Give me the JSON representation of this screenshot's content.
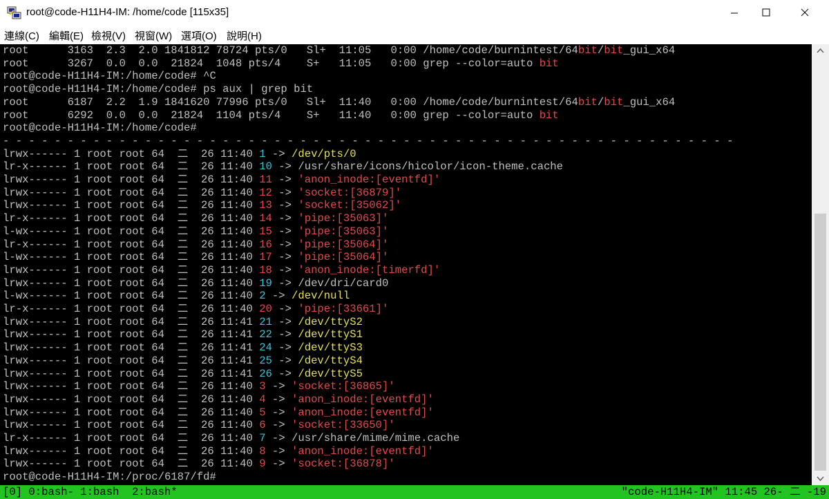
{
  "window": {
    "title": "root@code-H11H4-IM: /home/code [115x35]",
    "icons": [
      "putty-app-icon",
      "minimize-icon",
      "maximize-icon",
      "close-icon"
    ]
  },
  "menu": [
    "連線(C)",
    "編輯(E)",
    "檢視(V)",
    "視窗(W)",
    "選項(O)",
    "說明(H)"
  ],
  "colors": {
    "terminal_bg": "#000000",
    "default_text": "#c0c0c0",
    "red": "#e24a4a",
    "cyan": "#3ec1d6",
    "yellow": "#e6e05a",
    "status_bg": "#22c422"
  },
  "terminal": {
    "lines": [
      [
        {
          "t": "root      3163  2.3  2.0 1841812 78724 pts/0   Sl+  11:05   0:00 /home/code/burnintest/64"
        },
        {
          "t": "bit",
          "c": "red"
        },
        {
          "t": "/"
        },
        {
          "t": "bit",
          "c": "red"
        },
        {
          "t": "_gui_x64"
        }
      ],
      [
        {
          "t": "root      3267  0.0  0.0  21824  1048 pts/4    S+   11:05   0:00 grep --color=auto "
        },
        {
          "t": "bit",
          "c": "red"
        }
      ],
      [
        {
          "t": "root@code-H11H4-IM:/home/code# ^C"
        }
      ],
      [
        {
          "t": "root@code-H11H4-IM:/home/code# ps aux | grep bit"
        }
      ],
      [
        {
          "t": "root      6187  2.2  1.9 1841620 77996 pts/0   Sl+  11:40   0:00 /home/code/burnintest/64"
        },
        {
          "t": "bit",
          "c": "red"
        },
        {
          "t": "/"
        },
        {
          "t": "bit",
          "c": "red"
        },
        {
          "t": "_gui_x64"
        }
      ],
      [
        {
          "t": "root      6292  0.0  0.0  21824  1104 pts/4    S+   11:40   0:00 grep --color=auto "
        },
        {
          "t": "bit",
          "c": "red"
        }
      ],
      [
        {
          "t": "root@code-H11H4-IM:/home/code#"
        }
      ],
      [
        {
          "t": "- - - - - - - - - - - - - - - - - - - - - - - - - - - - - - - - - - - - - - - - - - - - - - - - - - - - - - - - -"
        }
      ],
      [
        {
          "t": "lrwx------ 1 root root 64  二  26 11:40 "
        },
        {
          "t": "1",
          "c": "cyan"
        },
        {
          "t": " -> "
        },
        {
          "t": "/dev/pts/0",
          "c": "yellow"
        }
      ],
      [
        {
          "t": "lr-x------ 1 root root 64  二  26 11:40 "
        },
        {
          "t": "10",
          "c": "cyan"
        },
        {
          "t": " -> /usr/share/icons/hicolor/icon-theme.cache"
        }
      ],
      [
        {
          "t": "lrwx------ 1 root root 64  二  26 11:40 "
        },
        {
          "t": "11",
          "c": "red"
        },
        {
          "t": " -> "
        },
        {
          "t": "'anon_inode:[eventfd]'",
          "c": "red"
        }
      ],
      [
        {
          "t": "lrwx------ 1 root root 64  二  26 11:40 "
        },
        {
          "t": "12",
          "c": "red"
        },
        {
          "t": " -> "
        },
        {
          "t": "'socket:[36879]'",
          "c": "red"
        }
      ],
      [
        {
          "t": "lrwx------ 1 root root 64  二  26 11:40 "
        },
        {
          "t": "13",
          "c": "red"
        },
        {
          "t": " -> "
        },
        {
          "t": "'socket:[35062]'",
          "c": "red"
        }
      ],
      [
        {
          "t": "lr-x------ 1 root root 64  二  26 11:40 "
        },
        {
          "t": "14",
          "c": "red"
        },
        {
          "t": " -> "
        },
        {
          "t": "'pipe:[35063]'",
          "c": "red"
        }
      ],
      [
        {
          "t": "l-wx------ 1 root root 64  二  26 11:40 "
        },
        {
          "t": "15",
          "c": "red"
        },
        {
          "t": " -> "
        },
        {
          "t": "'pipe:[35063]'",
          "c": "red"
        }
      ],
      [
        {
          "t": "lr-x------ 1 root root 64  二  26 11:40 "
        },
        {
          "t": "16",
          "c": "red"
        },
        {
          "t": " -> "
        },
        {
          "t": "'pipe:[35064]'",
          "c": "red"
        }
      ],
      [
        {
          "t": "l-wx------ 1 root root 64  二  26 11:40 "
        },
        {
          "t": "17",
          "c": "red"
        },
        {
          "t": " -> "
        },
        {
          "t": "'pipe:[35064]'",
          "c": "red"
        }
      ],
      [
        {
          "t": "lrwx------ 1 root root 64  二  26 11:40 "
        },
        {
          "t": "18",
          "c": "red"
        },
        {
          "t": " -> "
        },
        {
          "t": "'anon_inode:[timerfd]'",
          "c": "red"
        }
      ],
      [
        {
          "t": "lrwx------ 1 root root 64  二  26 11:40 "
        },
        {
          "t": "19",
          "c": "cyan"
        },
        {
          "t": " -> /dev/dri/card0"
        }
      ],
      [
        {
          "t": "l-wx------ 1 root root 64  二  26 11:40 "
        },
        {
          "t": "2",
          "c": "cyan"
        },
        {
          "t": " -> "
        },
        {
          "t": "/dev/null",
          "c": "yellow"
        }
      ],
      [
        {
          "t": "lr-x------ 1 root root 64  二  26 11:40 "
        },
        {
          "t": "20",
          "c": "red"
        },
        {
          "t": " -> "
        },
        {
          "t": "'pipe:[33661]'",
          "c": "red"
        }
      ],
      [
        {
          "t": "lrwx------ 1 root root 64  二  26 11:41 "
        },
        {
          "t": "21",
          "c": "cyan"
        },
        {
          "t": " -> "
        },
        {
          "t": "/dev/ttyS2",
          "c": "yellow"
        }
      ],
      [
        {
          "t": "lrwx------ 1 root root 64  二  26 11:41 "
        },
        {
          "t": "22",
          "c": "cyan"
        },
        {
          "t": " -> "
        },
        {
          "t": "/dev/ttyS1",
          "c": "yellow"
        }
      ],
      [
        {
          "t": "lrwx------ 1 root root 64  二  26 11:41 "
        },
        {
          "t": "24",
          "c": "cyan"
        },
        {
          "t": " -> "
        },
        {
          "t": "/dev/ttyS3",
          "c": "yellow"
        }
      ],
      [
        {
          "t": "lrwx------ 1 root root 64  二  26 11:41 "
        },
        {
          "t": "25",
          "c": "cyan"
        },
        {
          "t": " -> "
        },
        {
          "t": "/dev/ttyS4",
          "c": "yellow"
        }
      ],
      [
        {
          "t": "lrwx------ 1 root root 64  二  26 11:41 "
        },
        {
          "t": "26",
          "c": "cyan"
        },
        {
          "t": " -> "
        },
        {
          "t": "/dev/ttyS5",
          "c": "yellow"
        }
      ],
      [
        {
          "t": "lrwx------ 1 root root 64  二  26 11:40 "
        },
        {
          "t": "3",
          "c": "red"
        },
        {
          "t": " -> "
        },
        {
          "t": "'socket:[36865]'",
          "c": "red"
        }
      ],
      [
        {
          "t": "lrwx------ 1 root root 64  二  26 11:40 "
        },
        {
          "t": "4",
          "c": "red"
        },
        {
          "t": " -> "
        },
        {
          "t": "'anon_inode:[eventfd]'",
          "c": "red"
        }
      ],
      [
        {
          "t": "lrwx------ 1 root root 64  二  26 11:40 "
        },
        {
          "t": "5",
          "c": "red"
        },
        {
          "t": " -> "
        },
        {
          "t": "'anon_inode:[eventfd]'",
          "c": "red"
        }
      ],
      [
        {
          "t": "lrwx------ 1 root root 64  二  26 11:40 "
        },
        {
          "t": "6",
          "c": "red"
        },
        {
          "t": " -> "
        },
        {
          "t": "'socket:[33650]'",
          "c": "red"
        }
      ],
      [
        {
          "t": "lr-x------ 1 root root 64  二  26 11:40 "
        },
        {
          "t": "7",
          "c": "cyan"
        },
        {
          "t": " -> /usr/share/mime/mime.cache"
        }
      ],
      [
        {
          "t": "lrwx------ 1 root root 64  二  26 11:40 "
        },
        {
          "t": "8",
          "c": "red"
        },
        {
          "t": " -> "
        },
        {
          "t": "'anon_inode:[eventfd]'",
          "c": "red"
        }
      ],
      [
        {
          "t": "lrwx------ 1 root root 64  二  26 11:40 "
        },
        {
          "t": "9",
          "c": "red"
        },
        {
          "t": " -> "
        },
        {
          "t": "'socket:[36878]'",
          "c": "red"
        }
      ],
      [
        {
          "t": "root@code-H11H4-IM:/proc/6187/fd#"
        }
      ]
    ]
  },
  "statusbar": {
    "left": "[0] 0:bash- 1:bash  2:bash*",
    "right": "\"code-H11H4-IM\" 11:45 26- 二 -19"
  }
}
